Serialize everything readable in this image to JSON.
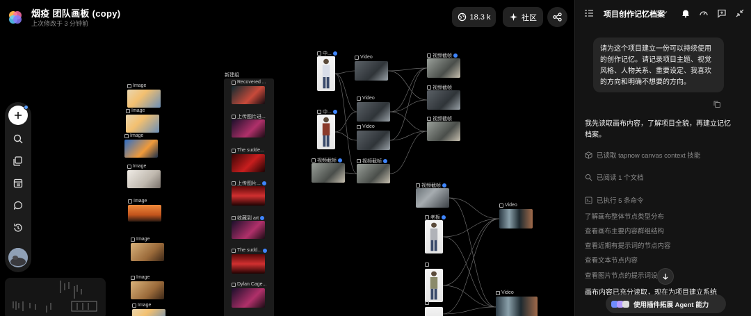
{
  "header": {
    "title": "烟疫 团队画板 (copy)",
    "subtitle": "上次修改于 3 分钟前",
    "views_count": "18.3 k",
    "community_label": "社区"
  },
  "toolbar": {
    "items": [
      "add",
      "search",
      "assets",
      "layers",
      "comments",
      "history"
    ]
  },
  "canvas": {
    "group_title": "新建组",
    "col1_labels": [
      "Image",
      "Image",
      "Image",
      "Image",
      "Image",
      "Image",
      "Image",
      "Image"
    ],
    "group_labels": [
      "Recovered ...",
      "上传图片进...",
      "The sudde...",
      "上传图片...",
      "收藏到 art",
      "The sudd...",
      "Dylan Cage..."
    ],
    "col3_labels": [
      "中...",
      "中...",
      "视频截帧"
    ],
    "col4_labels": [
      "Video",
      "Video",
      "Video",
      "视频截帧"
    ],
    "col5_labels": [
      "视频截帧",
      "视频截帧",
      "视频截帧"
    ],
    "col6_labels": [
      "视频截帧",
      "老板",
      "",
      ""
    ],
    "col7_labels": [
      "Video",
      "Video"
    ]
  },
  "panel": {
    "title": "项目创作记忆档案",
    "user_message": "请为这个项目建立一份可以持续使用的创作记忆。请记录项目主题、视觉风格、人物关系、重要设定、我喜欢的方向和明确不想要的方向。",
    "reply": "我先读取画布内容，了解项目全貌，再建立记忆档案。",
    "step1": "已读取 tapnow canvas context 技能",
    "step2": "已阅读 1 个文档",
    "step3": "已执行 5 条命令",
    "commands": [
      "了解画布整体节点类型分布",
      "查看画布主要内容群组结构",
      "查看近期有提示词的节点内容",
      "查看文本节点内容",
      "查看图片节点的提示词设"
    ],
    "tail": "画布内容已充分读取，现在为项目建立系统",
    "agent_pill": "使用插件拓展 Agent 能力"
  }
}
